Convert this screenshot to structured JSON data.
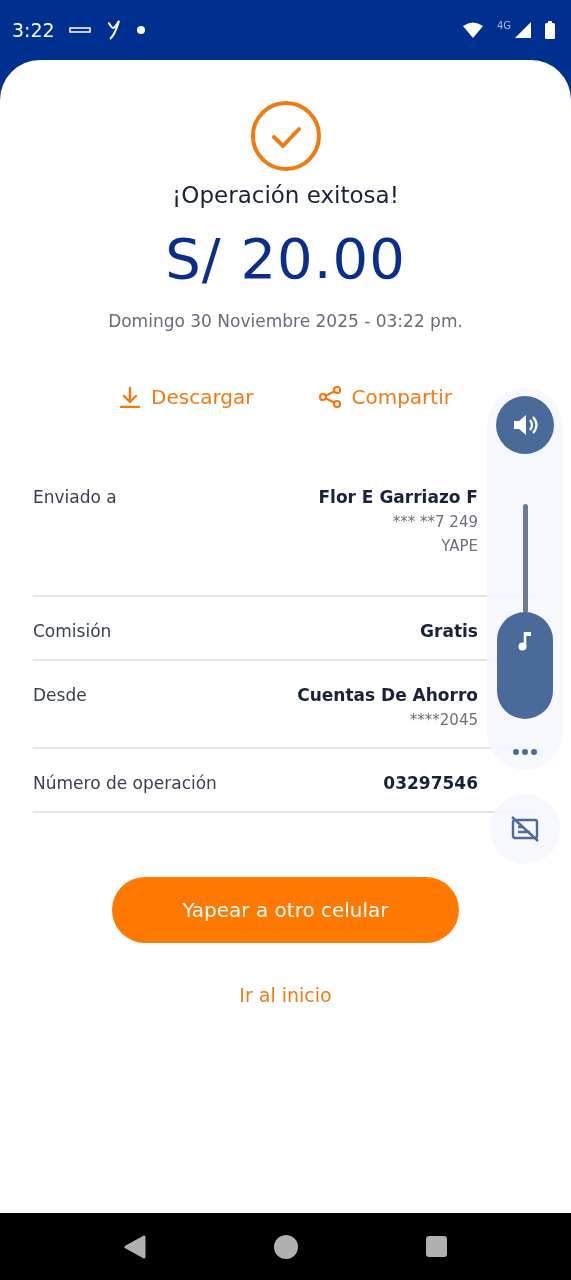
{
  "status_bar": {
    "time": "3:22",
    "network": "4G"
  },
  "receipt": {
    "title": "¡Operación exitosa!",
    "amount": "S/ 20.00",
    "date": "Domingo 30 Noviembre 2025 - 03:22 pm.",
    "actions": [
      {
        "kind": "download",
        "label": "Descargar"
      },
      {
        "kind": "share",
        "label": "Compartir"
      }
    ],
    "details": [
      {
        "label": "Enviado a",
        "values": [
          "Flor E Garriazo F",
          "*** **7 249",
          "YAPE"
        ]
      },
      {
        "label": "Comisión",
        "values": [
          "Gratis"
        ]
      },
      {
        "label": "Desde",
        "values": [
          "Cuentas De Ahorro",
          "****2045"
        ]
      },
      {
        "label": "Número de operación",
        "values": [
          "03297546"
        ]
      }
    ],
    "primary_button": "Yapear a otro celular",
    "link": "Ir al inicio"
  },
  "volume_panel": {
    "level": 0.5
  }
}
